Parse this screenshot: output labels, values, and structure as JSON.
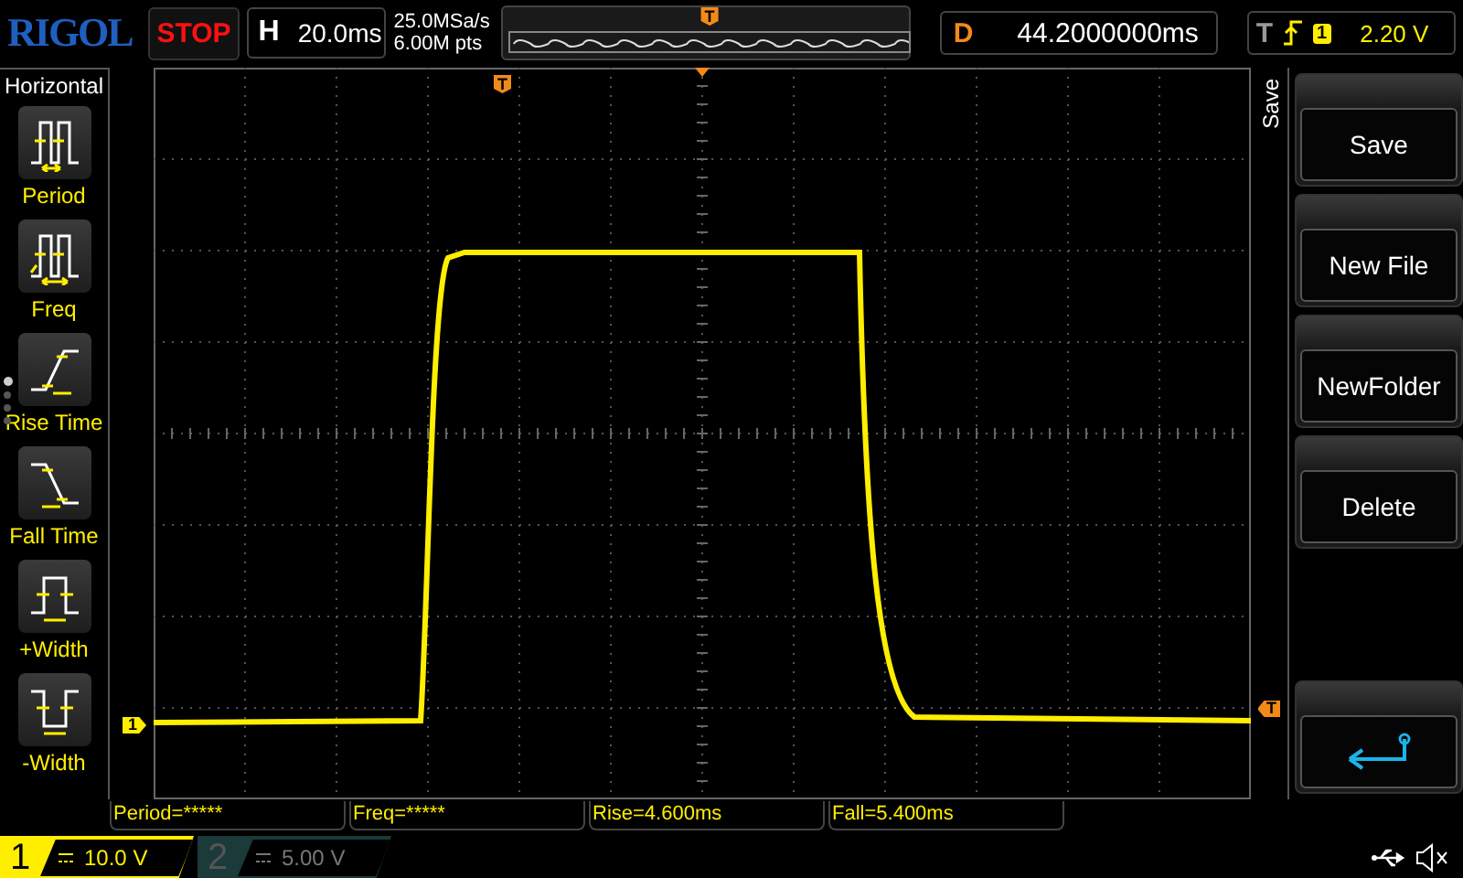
{
  "top_bar": {
    "brand": "RIGOL",
    "run_state": "STOP",
    "horizontal": {
      "label": "H",
      "value": "20.0ms"
    },
    "sample_rate": "25.0MSa/s",
    "memory_depth": "6.00M pts",
    "memory_trigger": "T",
    "delay": {
      "label": "D",
      "value": "44.2000000ms"
    },
    "trigger": {
      "label": "T",
      "source": "1",
      "level": "2.20 V"
    }
  },
  "left_menu": {
    "title": "Horizontal",
    "items": [
      {
        "label": "Period",
        "kind": "period",
        "selected": false
      },
      {
        "label": "Freq",
        "kind": "freq",
        "selected": false
      },
      {
        "label": "Rise Time",
        "kind": "rise",
        "selected": false
      },
      {
        "label": "Fall Time",
        "kind": "fall",
        "selected": false
      },
      {
        "label": "+Width",
        "kind": "pwidth",
        "selected": false
      },
      {
        "label": "-Width",
        "kind": "nwidth",
        "selected": false
      }
    ],
    "page_dots": [
      {
        "selected": true
      },
      {
        "selected": false
      },
      {
        "selected": false
      },
      {
        "selected": false
      }
    ]
  },
  "plot": {
    "channel_marker": "1",
    "trigger_level_marker": "T",
    "trigger_position_marker": "T"
  },
  "measurements": [
    "Period=*****",
    "Freq=*****",
    "Rise=4.600ms",
    "Fall=5.400ms"
  ],
  "channels": [
    {
      "number": "1",
      "scale": "10.0 V",
      "on": true
    },
    {
      "number": "2",
      "scale": "5.00 V",
      "on": false
    }
  ],
  "right_menu": {
    "title": "Save",
    "buttons": [
      {
        "label": "Save",
        "kind": "text"
      },
      {
        "label": "New File",
        "kind": "text"
      },
      {
        "label": "NewFolder",
        "kind": "text"
      },
      {
        "label": "Delete",
        "kind": "text"
      },
      {
        "kind": "spacer"
      },
      {
        "kind": "back"
      }
    ]
  }
}
